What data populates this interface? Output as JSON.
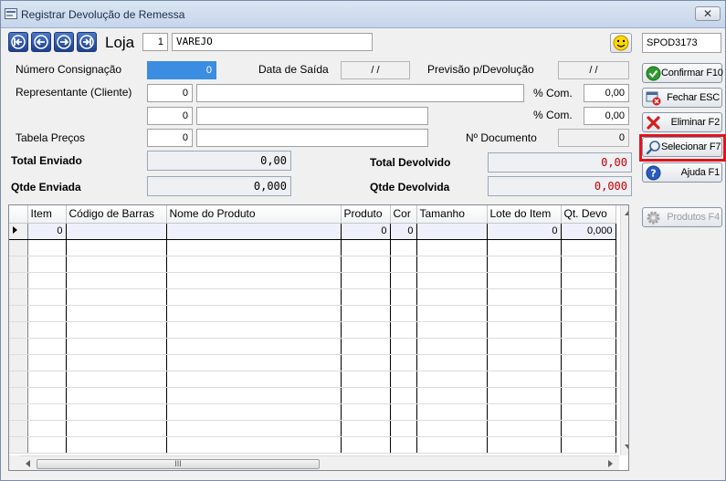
{
  "window": {
    "title": "Registrar Devolução de Remessa",
    "close_label": "✕"
  },
  "header": {
    "loja_label": "Loja",
    "loja_code": "1",
    "loja_name": "VAREJO",
    "user_code": "SPOD3173"
  },
  "form": {
    "numero_consignacao_label": "Número Consignação",
    "numero_consignacao": "0",
    "data_saida_label": "Data de Saída",
    "data_saida": "/ /",
    "previsao_label": "Previsão p/Devolução",
    "previsao": "/ /",
    "representante_label": "Representante (Cliente)",
    "representante_code": "0",
    "representante_name": "",
    "com_label": "% Com.",
    "com1": "0,00",
    "second_code": "0",
    "second_name": "",
    "com2": "0,00",
    "tabela_label": "Tabela Preços",
    "tabela_code": "0",
    "tabela_name": "",
    "documento_label": "Nº Documento",
    "documento": "0"
  },
  "totals": {
    "total_enviado_label": "Total Enviado",
    "total_enviado": "0,00",
    "qtde_enviada_label": "Qtde Enviada",
    "qtde_enviada": "0,000",
    "total_devolvido_label": "Total Devolvido",
    "total_devolvido": "0,00",
    "qtde_devolvida_label": "Qtde Devolvida",
    "qtde_devolvida": "0,000"
  },
  "buttons": {
    "confirmar": "Confirmar F10",
    "fechar": "Fechar ESC",
    "eliminar": "Eliminar  F2",
    "selecionar": "Selecionar F7",
    "ajuda": "Ajuda     F1",
    "produtos": "Produtos F4"
  },
  "grid": {
    "columns": [
      "Item",
      "Código de Barras",
      "Nome do Produto",
      "Produto",
      "Cor",
      "Tamanho",
      "Lote do Item",
      "Qt. Devo"
    ],
    "first_row": {
      "item": "0",
      "codigo": "",
      "nome": "",
      "produto": "0",
      "cor": "0",
      "tamanho": "",
      "lote": "0",
      "qt": "0,000"
    },
    "hscroll_grip": "III"
  },
  "colors": {
    "highlight": "#e0141e",
    "total_red": "#c00000",
    "nav_blue": "#1f3f8c"
  }
}
